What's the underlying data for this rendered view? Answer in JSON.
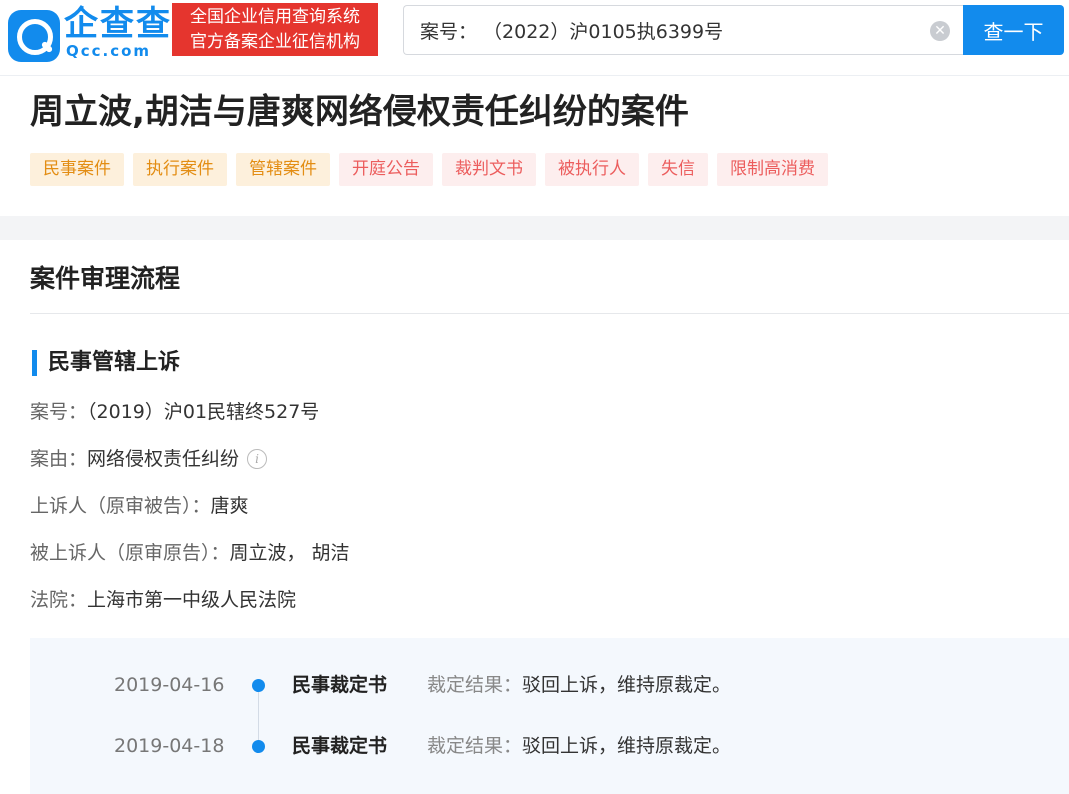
{
  "header": {
    "logo_name": "企查查",
    "logo_domain": "Qcc.com",
    "slogan_line1": "全国企业信用查询系统",
    "slogan_line2": "官方备案企业征信机构",
    "search_value": "案号： （2022）沪0105执6399号",
    "search_button": "查一下"
  },
  "case": {
    "title": "周立波,胡洁与唐爽网络侵权责任纠纷的案件",
    "tags": [
      "民事案件",
      "执行案件",
      "管辖案件",
      "开庭公告",
      "裁判文书",
      "被执行人",
      "失信",
      "限制高消费"
    ]
  },
  "process": {
    "section_title": "案件审理流程",
    "stage_title": "民事管辖上诉",
    "fields": [
      {
        "label": "案号：",
        "value": "（2019）沪01民辖终527号"
      },
      {
        "label": "案由：",
        "value": "网络侵权责任纠纷"
      },
      {
        "label": "上诉人（原审被告）：",
        "value": "唐爽"
      },
      {
        "label": "被上诉人（原审原告）：",
        "value": "周立波， 胡洁"
      },
      {
        "label": "法院：",
        "value": "上海市第一中级人民法院"
      }
    ],
    "timeline": [
      {
        "date": "2019-04-16",
        "doc": "民事裁定书",
        "result_label": "裁定结果：",
        "result": "驳回上诉，维持原裁定。"
      },
      {
        "date": "2019-04-18",
        "doc": "民事裁定书",
        "result_label": "裁定结果：",
        "result": "驳回上诉，维持原裁定。"
      }
    ]
  },
  "colors": {
    "brand": "#128bed",
    "slogan_bg": "#e5352e",
    "tag_orange": "#e38d13",
    "tag_red": "#ec5d5d"
  },
  "icons": [
    "logo-icon",
    "clear-icon",
    "info-icon"
  ]
}
